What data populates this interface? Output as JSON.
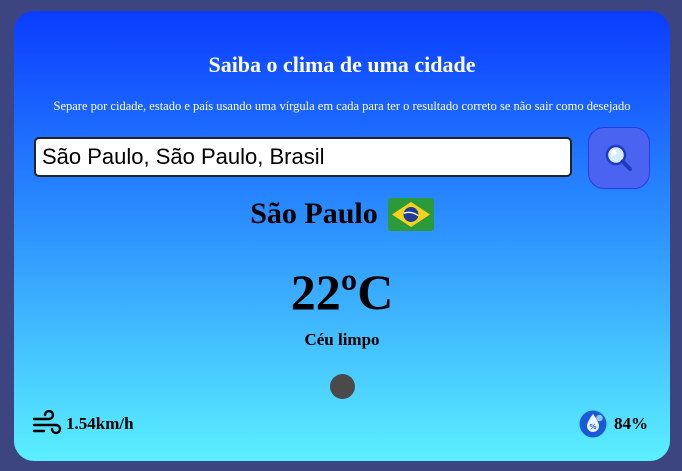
{
  "header": {
    "title": "Saiba o clima de uma cidade",
    "subtitle": "Separe por cidade, estado e país usando uma vírgula em cada para ter o resultado correto se não sair como desejado"
  },
  "search": {
    "value": "São Paulo, São Paulo, Brasil",
    "icon": "magnifier-icon"
  },
  "result": {
    "city": "São Paulo",
    "country_flag": "brazil-flag",
    "temperature": "22ºC",
    "description": "Céu limpo",
    "weather_icon": "clear-sky-icon"
  },
  "stats": {
    "wind": "1.54km/h",
    "wind_icon": "wind-icon",
    "humidity": "84%",
    "humidity_icon": "humidity-icon"
  },
  "colors": {
    "background": "#3d4580",
    "card_top": "#0a3cff",
    "card_bottom": "#5bf0ff",
    "search_button": "#4a63f0"
  }
}
